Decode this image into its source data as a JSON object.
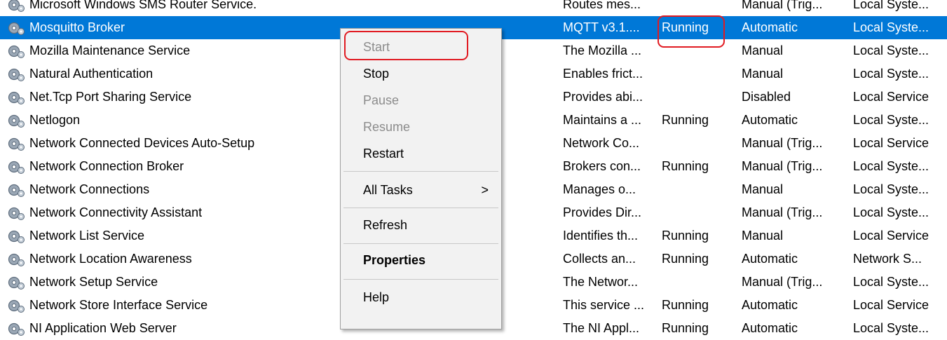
{
  "services": {
    "rows": [
      {
        "name": "Microsoft Windows SMS Router Service.",
        "description": "Routes mes...",
        "status": "",
        "startup": "Manual (Trig...",
        "logon": "Local Syste..."
      },
      {
        "name": "Mosquitto Broker",
        "description": "MQTT v3.1....",
        "status": "Running",
        "startup": "Automatic",
        "logon": "Local Syste..."
      },
      {
        "name": "Mozilla Maintenance Service",
        "description": "The Mozilla ...",
        "status": "",
        "startup": "Manual",
        "logon": "Local Syste..."
      },
      {
        "name": "Natural Authentication",
        "description": "Enables frict...",
        "status": "",
        "startup": "Manual",
        "logon": "Local Syste..."
      },
      {
        "name": "Net.Tcp Port Sharing Service",
        "description": "Provides abi...",
        "status": "",
        "startup": "Disabled",
        "logon": "Local Service"
      },
      {
        "name": "Netlogon",
        "description": "Maintains a ...",
        "status": "Running",
        "startup": "Automatic",
        "logon": "Local Syste..."
      },
      {
        "name": "Network Connected Devices Auto-Setup",
        "description": "Network Co...",
        "status": "",
        "startup": "Manual (Trig...",
        "logon": "Local Service"
      },
      {
        "name": "Network Connection Broker",
        "description": "Brokers con...",
        "status": "Running",
        "startup": "Manual (Trig...",
        "logon": "Local Syste..."
      },
      {
        "name": "Network Connections",
        "description": "Manages o...",
        "status": "",
        "startup": "Manual",
        "logon": "Local Syste..."
      },
      {
        "name": "Network Connectivity Assistant",
        "description": "Provides Dir...",
        "status": "",
        "startup": "Manual (Trig...",
        "logon": "Local Syste..."
      },
      {
        "name": "Network List Service",
        "description": "Identifies th...",
        "status": "Running",
        "startup": "Manual",
        "logon": "Local Service"
      },
      {
        "name": "Network Location Awareness",
        "description": "Collects an...",
        "status": "Running",
        "startup": "Automatic",
        "logon": "Network S..."
      },
      {
        "name": "Network Setup Service",
        "description": "The Networ...",
        "status": "",
        "startup": "Manual (Trig...",
        "logon": "Local Syste..."
      },
      {
        "name": "Network Store Interface Service",
        "description": "This service ...",
        "status": "Running",
        "startup": "Automatic",
        "logon": "Local Service"
      },
      {
        "name": "NI Application Web Server",
        "description": "The NI Appl...",
        "status": "Running",
        "startup": "Automatic",
        "logon": "Local Syste..."
      }
    ]
  },
  "context_menu": {
    "start": "Start",
    "stop": "Stop",
    "pause": "Pause",
    "resume": "Resume",
    "restart": "Restart",
    "all_tasks": "All Tasks",
    "all_tasks_arrow": ">",
    "refresh": "Refresh",
    "properties": "Properties",
    "help": "Help"
  },
  "colors": {
    "selection": "#0078d7",
    "highlight_outline": "#e11b22",
    "menu_background": "#f2f2f2",
    "disabled_text": "#8c8c8c"
  },
  "icons": {
    "service": "service-gear-icon",
    "submenu": "chevron-right-icon"
  }
}
